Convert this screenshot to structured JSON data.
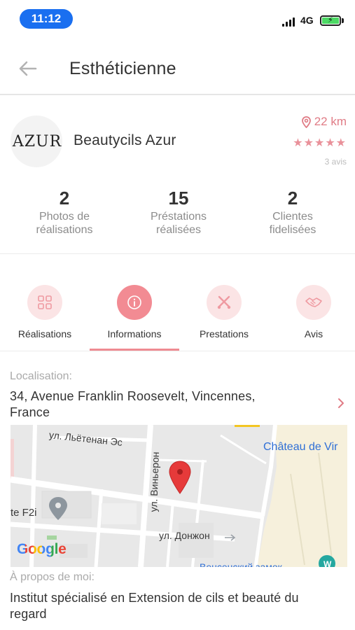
{
  "status_bar": {
    "time": "11:12",
    "network": "4G"
  },
  "header": {
    "title": "Esthéticienne",
    "back_icon": "arrow-left-icon"
  },
  "profile": {
    "avatar_text": "AZUR",
    "name": "Beautycils Azur",
    "distance": "22 km",
    "rating": 5,
    "rating_stars": "★★★★★",
    "reviews": "3 avis"
  },
  "stats": [
    {
      "value": "2",
      "label_line1": "Photos de",
      "label_line2": "réalisations"
    },
    {
      "value": "15",
      "label_line1": "Préstations",
      "label_line2": "réalisées"
    },
    {
      "value": "2",
      "label_line1": "Clientes",
      "label_line2": "fidelisées"
    }
  ],
  "tabs": [
    {
      "label": "Réalisations",
      "icon": "grid-icon",
      "active": false
    },
    {
      "label": "Informations",
      "icon": "info-icon",
      "active": true
    },
    {
      "label": "Prestations",
      "icon": "tools-icon",
      "active": false
    },
    {
      "label": "Avis",
      "icon": "handshake-icon",
      "active": false
    }
  ],
  "location": {
    "label": "Localisation:",
    "address_line1": "34, Avenue Franklin Roosevelt, Vincennes,",
    "address_line2": "France"
  },
  "map": {
    "street1": "ул. Льётенан Эс",
    "street2": "ул. Виньерон",
    "street3": "ул. Донжон",
    "place1": "Château de Vir",
    "place2": "te F2i",
    "place3": "Венсенский замок",
    "brand": "Google"
  },
  "about": {
    "label": "À propos de moi:",
    "text_line1": "Institut spécialisé en Extension de cils et beauté du",
    "text_line2": "regard"
  },
  "colors": {
    "accent": "#ef8b92",
    "accent_light": "#fbe4e5",
    "time_pill": "#1a6ff0"
  }
}
